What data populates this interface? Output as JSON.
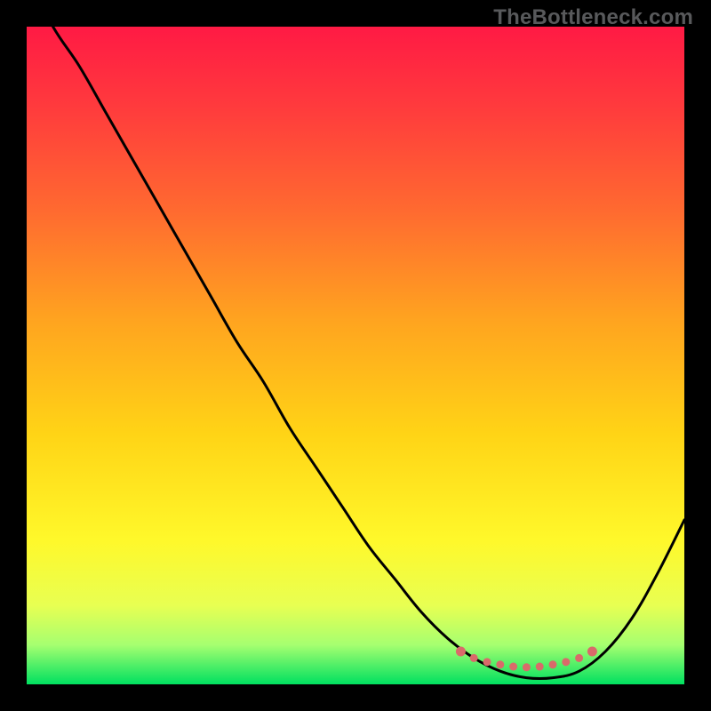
{
  "watermark": "TheBottleneck.com",
  "colors": {
    "background": "#000000",
    "curve": "#000000",
    "dots": "#d96a6a",
    "gradient_stops": [
      {
        "offset": 0.0,
        "color": "#ff1a44"
      },
      {
        "offset": 0.12,
        "color": "#ff3a3d"
      },
      {
        "offset": 0.28,
        "color": "#ff6a30"
      },
      {
        "offset": 0.45,
        "color": "#ffa51f"
      },
      {
        "offset": 0.62,
        "color": "#ffd416"
      },
      {
        "offset": 0.78,
        "color": "#fff82a"
      },
      {
        "offset": 0.88,
        "color": "#e8ff52"
      },
      {
        "offset": 0.94,
        "color": "#a6ff70"
      },
      {
        "offset": 1.0,
        "color": "#00e060"
      }
    ]
  },
  "chart_data": {
    "type": "line",
    "title": "",
    "xlabel": "",
    "ylabel": "",
    "xlim": [
      0,
      100
    ],
    "ylim": [
      0,
      100
    ],
    "series": [
      {
        "name": "bottleneck-curve",
        "x": [
          0,
          4,
          8,
          12,
          16,
          20,
          24,
          28,
          32,
          36,
          40,
          44,
          48,
          52,
          56,
          60,
          64,
          68,
          72,
          76,
          80,
          84,
          88,
          92,
          96,
          100
        ],
        "values": [
          108,
          100,
          94,
          87,
          80,
          73,
          66,
          59,
          52,
          46,
          39,
          33,
          27,
          21,
          16,
          11,
          7,
          4,
          2,
          1,
          1,
          2,
          5,
          10,
          17,
          25
        ]
      }
    ],
    "highlight_points": {
      "name": "optimal-range-dots",
      "x": [
        66,
        68,
        70,
        72,
        74,
        76,
        78,
        80,
        82,
        84,
        86
      ],
      "values": [
        5.0,
        4.0,
        3.4,
        3.0,
        2.7,
        2.6,
        2.7,
        3.0,
        3.4,
        4.0,
        5.0
      ]
    }
  }
}
